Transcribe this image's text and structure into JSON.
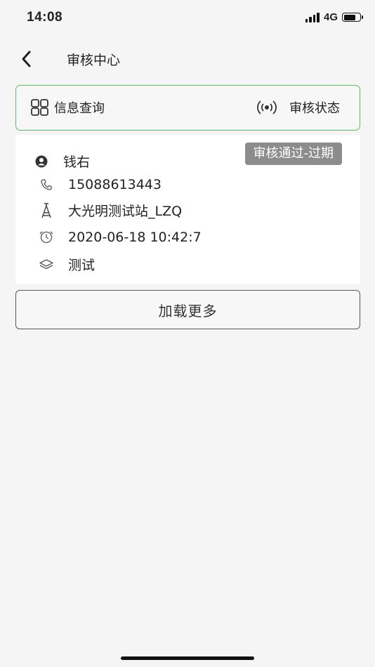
{
  "status_bar": {
    "time": "14:08",
    "network": "4G",
    "battery_level": 0.75,
    "signal_bars": 4
  },
  "header": {
    "title": "审核中心",
    "back_icon": "chevron-left-icon"
  },
  "tabs": {
    "info_query": {
      "label": "信息查询",
      "icon": "grid-icon"
    },
    "review_status": {
      "label": "审核状态",
      "icon": "broadcast-icon"
    },
    "active_border_color": "#5bbf5b"
  },
  "record": {
    "status": "审核通过-过期",
    "name": "钱右",
    "phone": "15088613443",
    "station": "大光明测试站_LZQ",
    "datetime": "2020-06-18 10:42:7",
    "category": "测试"
  },
  "actions": {
    "load_more": "加载更多"
  }
}
